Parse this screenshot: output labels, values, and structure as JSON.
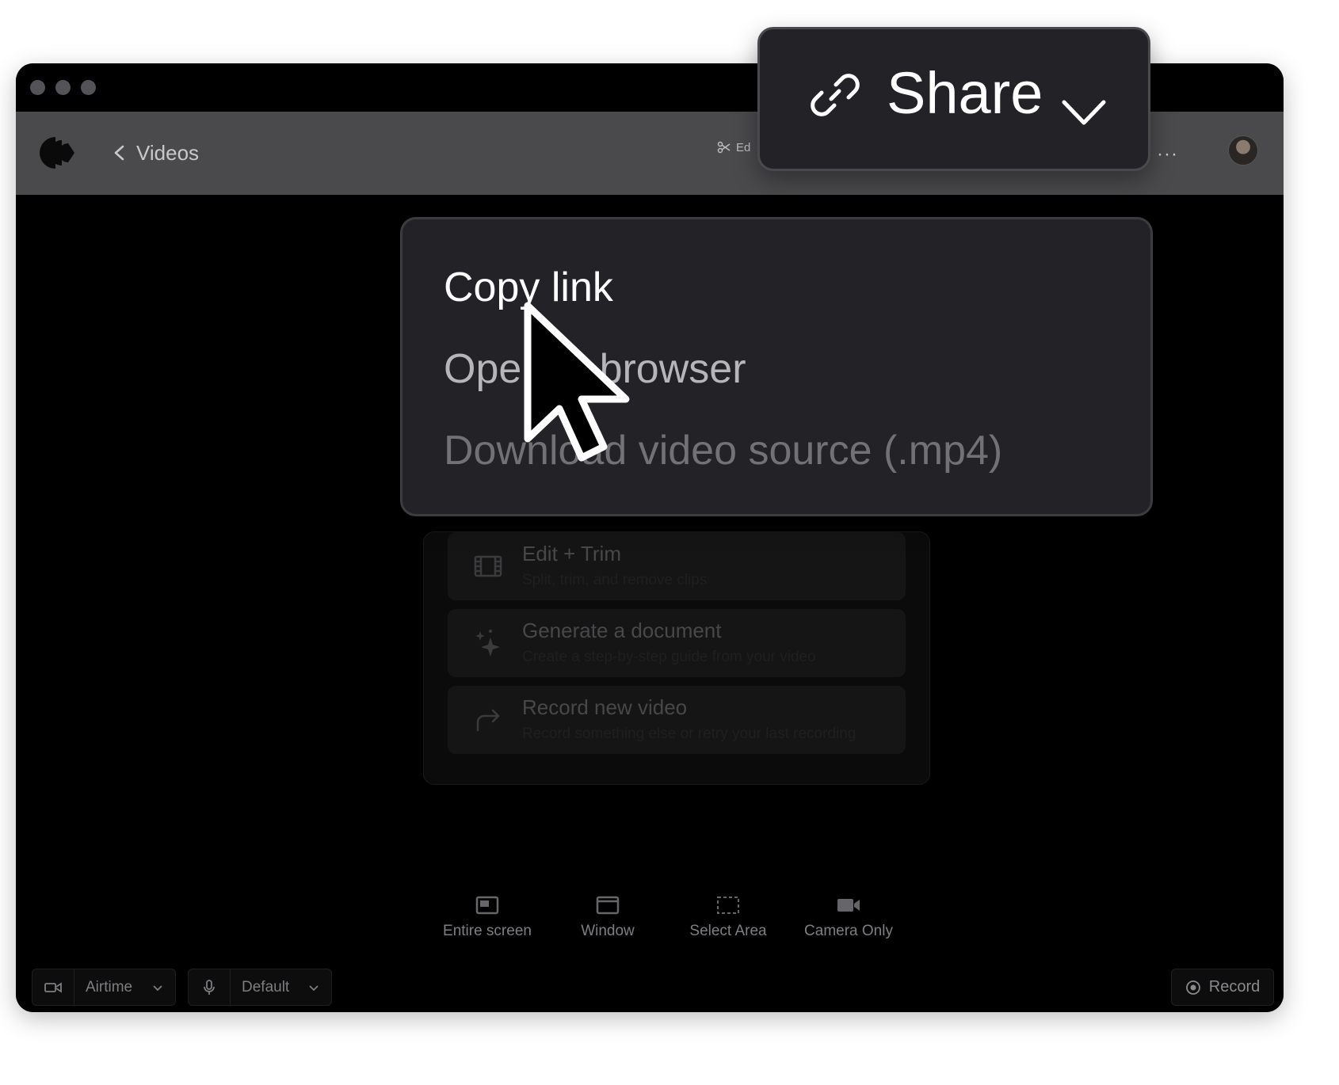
{
  "toolbar": {
    "back_label": "Videos",
    "edit_label": "Ed",
    "more_label": "···"
  },
  "share_button": {
    "label": "Share",
    "icon": "link-icon"
  },
  "share_menu": {
    "items": [
      {
        "label": "Copy link"
      },
      {
        "label": "Open in browser"
      },
      {
        "label": "Download video source (.mp4)"
      }
    ]
  },
  "actions": {
    "items": [
      {
        "title": "Edit + Trim",
        "subtitle": "Split, trim, and remove clips",
        "icon": "film-icon"
      },
      {
        "title": "Generate a document",
        "subtitle": "Create a step-by-step guide from your video",
        "icon": "sparkle-icon"
      },
      {
        "title": "Record new video",
        "subtitle": "Record something else or retry your last recording",
        "icon": "redo-arrow-icon"
      }
    ]
  },
  "capture_modes": [
    {
      "label": "Entire screen",
      "icon": "screen-icon"
    },
    {
      "label": "Window",
      "icon": "window-icon"
    },
    {
      "label": "Select Area",
      "icon": "select-area-icon"
    },
    {
      "label": "Camera Only",
      "icon": "camera-icon"
    }
  ],
  "devices": {
    "camera": "Airtime",
    "microphone": "Default"
  },
  "record_label": "Record",
  "colors": {
    "menu_bg": "#232327",
    "toolbar_bg": "#4a4a4c",
    "window_bg": "#000000"
  }
}
